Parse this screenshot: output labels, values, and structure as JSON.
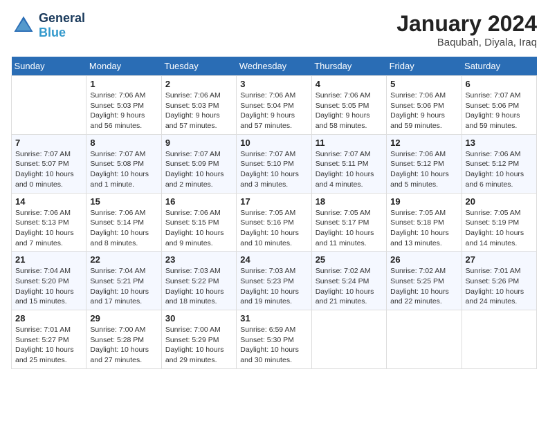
{
  "header": {
    "logo_general": "General",
    "logo_blue": "Blue",
    "month_title": "January 2024",
    "location": "Baqubah, Diyala, Iraq"
  },
  "days_of_week": [
    "Sunday",
    "Monday",
    "Tuesday",
    "Wednesday",
    "Thursday",
    "Friday",
    "Saturday"
  ],
  "weeks": [
    [
      {
        "day": "",
        "sunrise": "",
        "sunset": "",
        "daylight": ""
      },
      {
        "day": "1",
        "sunrise": "Sunrise: 7:06 AM",
        "sunset": "Sunset: 5:03 PM",
        "daylight": "Daylight: 9 hours and 56 minutes."
      },
      {
        "day": "2",
        "sunrise": "Sunrise: 7:06 AM",
        "sunset": "Sunset: 5:03 PM",
        "daylight": "Daylight: 9 hours and 57 minutes."
      },
      {
        "day": "3",
        "sunrise": "Sunrise: 7:06 AM",
        "sunset": "Sunset: 5:04 PM",
        "daylight": "Daylight: 9 hours and 57 minutes."
      },
      {
        "day": "4",
        "sunrise": "Sunrise: 7:06 AM",
        "sunset": "Sunset: 5:05 PM",
        "daylight": "Daylight: 9 hours and 58 minutes."
      },
      {
        "day": "5",
        "sunrise": "Sunrise: 7:06 AM",
        "sunset": "Sunset: 5:06 PM",
        "daylight": "Daylight: 9 hours and 59 minutes."
      },
      {
        "day": "6",
        "sunrise": "Sunrise: 7:07 AM",
        "sunset": "Sunset: 5:06 PM",
        "daylight": "Daylight: 9 hours and 59 minutes."
      }
    ],
    [
      {
        "day": "7",
        "sunrise": "Sunrise: 7:07 AM",
        "sunset": "Sunset: 5:07 PM",
        "daylight": "Daylight: 10 hours and 0 minutes."
      },
      {
        "day": "8",
        "sunrise": "Sunrise: 7:07 AM",
        "sunset": "Sunset: 5:08 PM",
        "daylight": "Daylight: 10 hours and 1 minute."
      },
      {
        "day": "9",
        "sunrise": "Sunrise: 7:07 AM",
        "sunset": "Sunset: 5:09 PM",
        "daylight": "Daylight: 10 hours and 2 minutes."
      },
      {
        "day": "10",
        "sunrise": "Sunrise: 7:07 AM",
        "sunset": "Sunset: 5:10 PM",
        "daylight": "Daylight: 10 hours and 3 minutes."
      },
      {
        "day": "11",
        "sunrise": "Sunrise: 7:07 AM",
        "sunset": "Sunset: 5:11 PM",
        "daylight": "Daylight: 10 hours and 4 minutes."
      },
      {
        "day": "12",
        "sunrise": "Sunrise: 7:06 AM",
        "sunset": "Sunset: 5:12 PM",
        "daylight": "Daylight: 10 hours and 5 minutes."
      },
      {
        "day": "13",
        "sunrise": "Sunrise: 7:06 AM",
        "sunset": "Sunset: 5:12 PM",
        "daylight": "Daylight: 10 hours and 6 minutes."
      }
    ],
    [
      {
        "day": "14",
        "sunrise": "Sunrise: 7:06 AM",
        "sunset": "Sunset: 5:13 PM",
        "daylight": "Daylight: 10 hours and 7 minutes."
      },
      {
        "day": "15",
        "sunrise": "Sunrise: 7:06 AM",
        "sunset": "Sunset: 5:14 PM",
        "daylight": "Daylight: 10 hours and 8 minutes."
      },
      {
        "day": "16",
        "sunrise": "Sunrise: 7:06 AM",
        "sunset": "Sunset: 5:15 PM",
        "daylight": "Daylight: 10 hours and 9 minutes."
      },
      {
        "day": "17",
        "sunrise": "Sunrise: 7:05 AM",
        "sunset": "Sunset: 5:16 PM",
        "daylight": "Daylight: 10 hours and 10 minutes."
      },
      {
        "day": "18",
        "sunrise": "Sunrise: 7:05 AM",
        "sunset": "Sunset: 5:17 PM",
        "daylight": "Daylight: 10 hours and 11 minutes."
      },
      {
        "day": "19",
        "sunrise": "Sunrise: 7:05 AM",
        "sunset": "Sunset: 5:18 PM",
        "daylight": "Daylight: 10 hours and 13 minutes."
      },
      {
        "day": "20",
        "sunrise": "Sunrise: 7:05 AM",
        "sunset": "Sunset: 5:19 PM",
        "daylight": "Daylight: 10 hours and 14 minutes."
      }
    ],
    [
      {
        "day": "21",
        "sunrise": "Sunrise: 7:04 AM",
        "sunset": "Sunset: 5:20 PM",
        "daylight": "Daylight: 10 hours and 15 minutes."
      },
      {
        "day": "22",
        "sunrise": "Sunrise: 7:04 AM",
        "sunset": "Sunset: 5:21 PM",
        "daylight": "Daylight: 10 hours and 17 minutes."
      },
      {
        "day": "23",
        "sunrise": "Sunrise: 7:03 AM",
        "sunset": "Sunset: 5:22 PM",
        "daylight": "Daylight: 10 hours and 18 minutes."
      },
      {
        "day": "24",
        "sunrise": "Sunrise: 7:03 AM",
        "sunset": "Sunset: 5:23 PM",
        "daylight": "Daylight: 10 hours and 19 minutes."
      },
      {
        "day": "25",
        "sunrise": "Sunrise: 7:02 AM",
        "sunset": "Sunset: 5:24 PM",
        "daylight": "Daylight: 10 hours and 21 minutes."
      },
      {
        "day": "26",
        "sunrise": "Sunrise: 7:02 AM",
        "sunset": "Sunset: 5:25 PM",
        "daylight": "Daylight: 10 hours and 22 minutes."
      },
      {
        "day": "27",
        "sunrise": "Sunrise: 7:01 AM",
        "sunset": "Sunset: 5:26 PM",
        "daylight": "Daylight: 10 hours and 24 minutes."
      }
    ],
    [
      {
        "day": "28",
        "sunrise": "Sunrise: 7:01 AM",
        "sunset": "Sunset: 5:27 PM",
        "daylight": "Daylight: 10 hours and 25 minutes."
      },
      {
        "day": "29",
        "sunrise": "Sunrise: 7:00 AM",
        "sunset": "Sunset: 5:28 PM",
        "daylight": "Daylight: 10 hours and 27 minutes."
      },
      {
        "day": "30",
        "sunrise": "Sunrise: 7:00 AM",
        "sunset": "Sunset: 5:29 PM",
        "daylight": "Daylight: 10 hours and 29 minutes."
      },
      {
        "day": "31",
        "sunrise": "Sunrise: 6:59 AM",
        "sunset": "Sunset: 5:30 PM",
        "daylight": "Daylight: 10 hours and 30 minutes."
      },
      {
        "day": "",
        "sunrise": "",
        "sunset": "",
        "daylight": ""
      },
      {
        "day": "",
        "sunrise": "",
        "sunset": "",
        "daylight": ""
      },
      {
        "day": "",
        "sunrise": "",
        "sunset": "",
        "daylight": ""
      }
    ]
  ]
}
